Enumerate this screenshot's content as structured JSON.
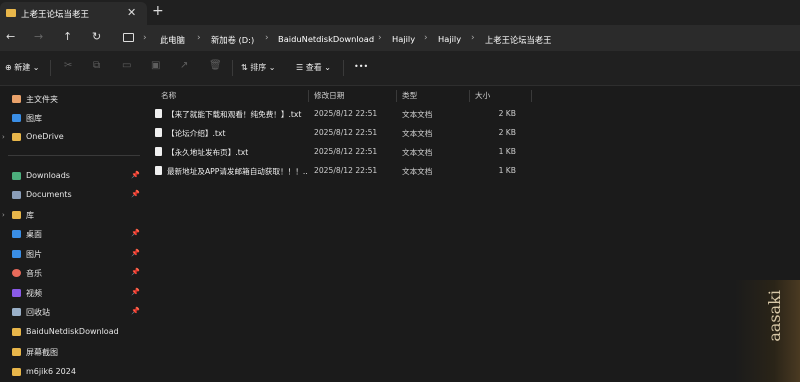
{
  "tab": {
    "title": "上老王论坛当老王",
    "close": "✕",
    "new_tab": "+"
  },
  "nav": {
    "back": "←",
    "forward": "→",
    "up": "↑",
    "refresh": "↻"
  },
  "breadcrumbs": [
    "此电脑",
    "新加卷 (D:)",
    "BaiduNetdiskDownload",
    "Hajily",
    "Hajily",
    "上老王论坛当老王"
  ],
  "breadcrumb_sep": "›",
  "toolbar": {
    "new_label": "新建",
    "cut": "✂",
    "copy": "⧉",
    "paste": "▭",
    "rename": "▣",
    "share": "↗",
    "delete": "🗑",
    "sort_label": "排序",
    "view_label": "查看",
    "more": "•••"
  },
  "sidebar": {
    "top": [
      {
        "label": "主文件夹",
        "icon": "home-icon",
        "color": "#e8a16a"
      },
      {
        "label": "图库",
        "icon": "gallery-icon",
        "color": "#3a8ee6"
      },
      {
        "label": "OneDrive",
        "icon": "folder-icon",
        "color": "#e8b64a"
      }
    ],
    "quick": [
      {
        "label": "Downloads",
        "icon": "download-icon",
        "color": "#4caf7d",
        "pinned": true
      },
      {
        "label": "Documents",
        "icon": "document-icon",
        "color": "#8a9db8",
        "pinned": true
      },
      {
        "label": "库",
        "icon": "folder-icon",
        "color": "#e8b64a",
        "pinned": false
      },
      {
        "label": "桌面",
        "icon": "desktop-icon",
        "color": "#3a8ee6",
        "pinned": true
      },
      {
        "label": "图片",
        "icon": "pictures-icon",
        "color": "#3a8ee6",
        "pinned": true
      },
      {
        "label": "音乐",
        "icon": "music-icon",
        "color": "#e86a5a",
        "pinned": true
      },
      {
        "label": "视频",
        "icon": "video-icon",
        "color": "#8a5ae8",
        "pinned": true
      },
      {
        "label": "回收站",
        "icon": "recycle-bin-icon",
        "color": "#9ab0c8",
        "pinned": true
      },
      {
        "label": "BaiduNetdiskDownload",
        "icon": "folder-icon",
        "color": "#e8b64a",
        "pinned": false
      },
      {
        "label": "屏幕截图",
        "icon": "folder-icon",
        "color": "#e8b64a",
        "pinned": false
      },
      {
        "label": "m6jik6  2024",
        "icon": "folder-icon",
        "color": "#e8b64a",
        "pinned": false
      }
    ],
    "pin_glyph": "📌",
    "chevron": "›"
  },
  "columns": {
    "name": "名称",
    "date": "修改日期",
    "type": "类型",
    "size": "大小"
  },
  "files": [
    {
      "name": "【来了就能下载和观看！纯免费！】.txt",
      "date": "2025/8/12 22:51",
      "type": "文本文档",
      "size": "2 KB"
    },
    {
      "name": "【论坛介绍】.txt",
      "date": "2025/8/12 22:51",
      "type": "文本文档",
      "size": "2 KB"
    },
    {
      "name": "【永久地址发布页】.txt",
      "date": "2025/8/12 22:51",
      "type": "文本文档",
      "size": "1 KB"
    },
    {
      "name": "最新地址及APP请发邮箱自动获取！！！...",
      "date": "2025/8/12 22:51",
      "type": "文本文档",
      "size": "1 KB"
    }
  ],
  "wallpaper_text": "aasaki"
}
